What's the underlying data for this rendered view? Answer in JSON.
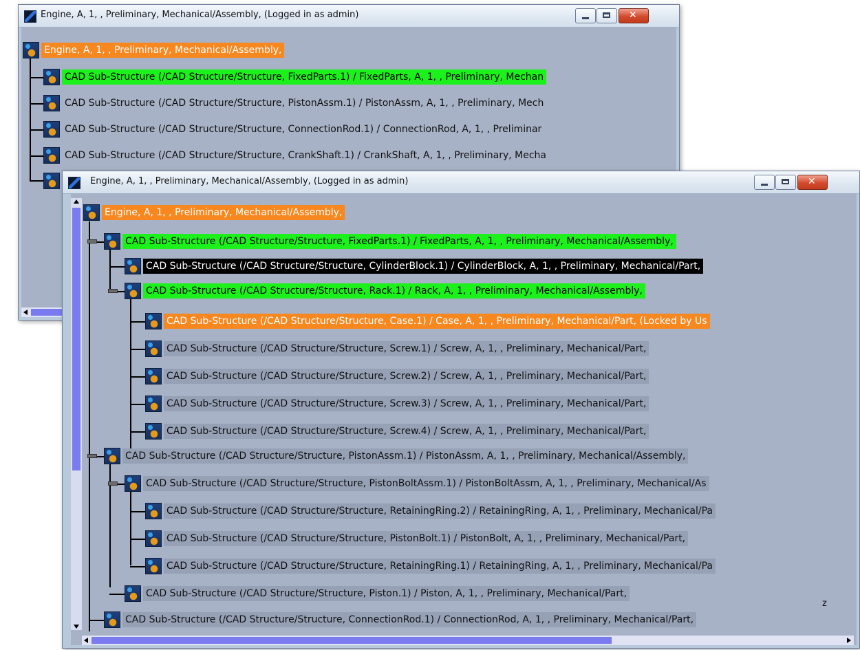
{
  "back_window": {
    "title": "Engine, A, 1, , Preliminary, Mechanical/Assembly,  (Logged in as admin)",
    "items": [
      {
        "label": "Engine, A, 1, , Preliminary, Mechanical/Assembly,",
        "highlight": "orange"
      },
      {
        "label": "CAD Sub-Structure (/CAD Structure/Structure, FixedParts.1) / FixedParts, A, 1, , Preliminary, Mechan",
        "highlight": "green"
      },
      {
        "label": "CAD Sub-Structure (/CAD Structure/Structure, PistonAssm.1) / PistonAssm, A, 1, , Preliminary, Mech",
        "highlight": "none"
      },
      {
        "label": "CAD Sub-Structure (/CAD Structure/Structure, ConnectionRod.1) / ConnectionRod, A, 1, , Preliminar",
        "highlight": "none"
      },
      {
        "label": "CAD Sub-Structure (/CAD Structure/Structure, CrankShaft.1) / CrankShaft, A, 1, , Preliminary, Mecha",
        "highlight": "none"
      }
    ]
  },
  "front_window": {
    "title": "Engine, A, 1, , Preliminary, Mechanical/Assembly,  (Logged in as admin)",
    "items": [
      {
        "label": "Engine, A, 1, , Preliminary, Mechanical/Assembly,",
        "highlight": "orange"
      },
      {
        "label": "CAD Sub-Structure (/CAD Structure/Structure, FixedParts.1) / FixedParts, A, 1, , Preliminary, Mechanical/Assembly,",
        "highlight": "green"
      },
      {
        "label": "CAD Sub-Structure (/CAD Structure/Structure, CylinderBlock.1) / CylinderBlock, A, 1, , Preliminary, Mechanical/Part,",
        "highlight": "black"
      },
      {
        "label": "CAD Sub-Structure (/CAD Structure/Structure, Rack.1) / Rack, A, 1, , Preliminary, Mechanical/Assembly,",
        "highlight": "green"
      },
      {
        "label": "CAD Sub-Structure (/CAD Structure/Structure, Case.1) / Case, A, 1, , Preliminary, Mechanical/Part,  (Locked by Us",
        "highlight": "orange"
      },
      {
        "label": "CAD Sub-Structure (/CAD Structure/Structure, Screw.1) / Screw, A, 1, , Preliminary, Mechanical/Part,",
        "highlight": "grey"
      },
      {
        "label": "CAD Sub-Structure (/CAD Structure/Structure, Screw.2) / Screw, A, 1, , Preliminary, Mechanical/Part,",
        "highlight": "grey"
      },
      {
        "label": "CAD Sub-Structure (/CAD Structure/Structure, Screw.3) / Screw, A, 1, , Preliminary, Mechanical/Part,",
        "highlight": "grey"
      },
      {
        "label": "CAD Sub-Structure (/CAD Structure/Structure, Screw.4) / Screw, A, 1, , Preliminary, Mechanical/Part,",
        "highlight": "grey"
      },
      {
        "label": "CAD Sub-Structure (/CAD Structure/Structure, PistonAssm.1) / PistonAssm, A, 1, , Preliminary, Mechanical/Assembly,",
        "highlight": "grey"
      },
      {
        "label": "CAD Sub-Structure (/CAD Structure/Structure, PistonBoltAssm.1) / PistonBoltAssm, A, 1, , Preliminary, Mechanical/As",
        "highlight": "grey"
      },
      {
        "label": "CAD Sub-Structure (/CAD Structure/Structure, RetainingRing.2) / RetainingRing, A, 1, , Preliminary, Mechanical/Pa",
        "highlight": "grey"
      },
      {
        "label": "CAD Sub-Structure (/CAD Structure/Structure, PistonBolt.1) / PistonBolt, A, 1, , Preliminary, Mechanical/Part,",
        "highlight": "grey"
      },
      {
        "label": "CAD Sub-Structure (/CAD Structure/Structure, RetainingRing.1) / RetainingRing, A, 1, , Preliminary, Mechanical/Pa",
        "highlight": "grey"
      },
      {
        "label": "CAD Sub-Structure (/CAD Structure/Structure, Piston.1) / Piston, A, 1, , Preliminary, Mechanical/Part,",
        "highlight": "grey"
      },
      {
        "label": "CAD Sub-Structure (/CAD Structure/Structure, ConnectionRod.1) / ConnectionRod, A, 1, , Preliminary, Mechanical/Part,",
        "highlight": "grey"
      }
    ],
    "compass_label": "z"
  },
  "icons": {
    "window_icon": "catia-app-icon",
    "node_icon": "product-assembly-icon",
    "close": "close-icon",
    "minimize": "minimize-icon",
    "maximize": "maximize-icon"
  },
  "colors": {
    "window_bg": "#a8b2c6",
    "highlight_orange": "#f7871f",
    "highlight_green": "#1cf11c",
    "highlight_black": "#000000",
    "scrollbar_thumb": "#7b7bf0"
  }
}
